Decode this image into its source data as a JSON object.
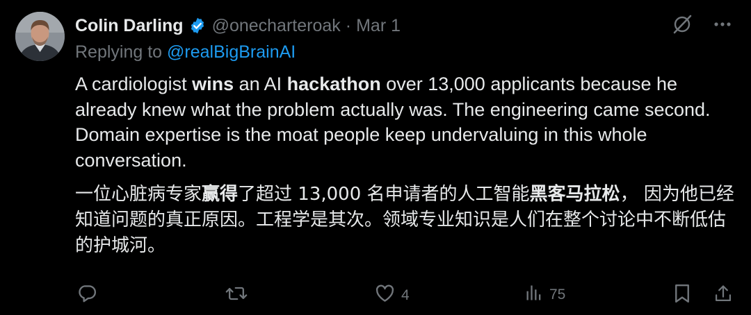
{
  "post": {
    "author": {
      "name": "Colin Darling",
      "verified": true,
      "handle": "@onecharteroak",
      "separator": "·",
      "date": "Mar 1"
    },
    "reply": {
      "prefix": "Replying to",
      "mention": "@realBigBrainAI"
    },
    "body_en": {
      "p1": "A cardiologist ",
      "b1": "wins",
      "p2": " an AI ",
      "b2": "hackathon",
      "p3": " over 13,000 applicants because he already knew what the problem actually was. The engineering came second. Domain expertise is the moat people keep undervaluing in this whole conversation."
    },
    "body_zh": {
      "p1": "一位心脏病专家",
      "b1": "赢得",
      "p2": "了超过 13,000 名申请者的人工智能",
      "b2": "黑客马拉松",
      "p3": "， 因为他已经知道问题的真正原因。工程学是其次。领域专业知识是人们在整个讨论中不断低估的护城河。"
    },
    "actions": {
      "replies": "",
      "reposts": "",
      "likes": "4",
      "views": "75"
    }
  },
  "icons": {
    "verified": "verified-badge-icon",
    "grok": "grok-icon",
    "more": "more-icon",
    "reply": "reply-icon",
    "repost": "repost-icon",
    "like": "heart-icon",
    "views": "views-icon",
    "bookmark": "bookmark-icon",
    "share": "share-icon"
  },
  "colors": {
    "background": "#000000",
    "text": "#e7e9ea",
    "muted": "#71767b",
    "accent": "#1d9bf0"
  }
}
